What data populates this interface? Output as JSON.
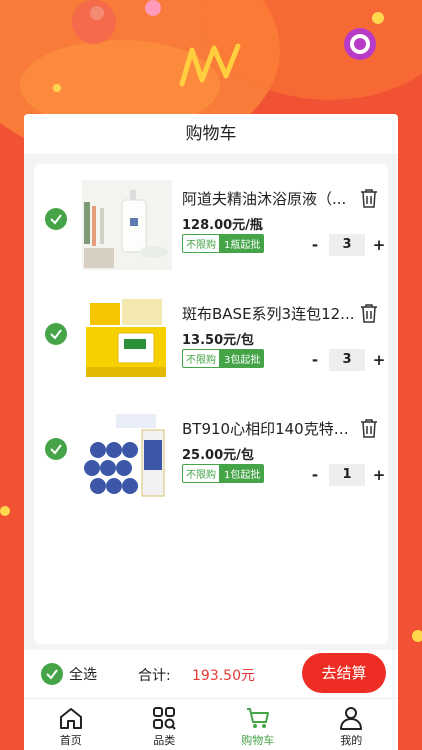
{
  "header": {
    "title": "购物车"
  },
  "items": [
    {
      "name": "阿道夫精油沐浴原液（...",
      "price": "128.00元/瓶",
      "tag_policy": "不限购",
      "tag_min": "1瓶起批",
      "qty": "3",
      "thumb": "bottle-image"
    },
    {
      "name": "斑布BASE系列3连包12...",
      "price": "13.50元/包",
      "tag_policy": "不限购",
      "tag_min": "3包起批",
      "qty": "3",
      "thumb": "tissue-box-image"
    },
    {
      "name": "BT910心相印140克特柔...",
      "price": "25.00元/包",
      "tag_policy": "不限购",
      "tag_min": "1包起批",
      "qty": "1",
      "thumb": "toilet-roll-image"
    }
  ],
  "footer": {
    "select_all": "全选",
    "total_label": "合计:",
    "total_value": "193.50元",
    "checkout": "去结算"
  },
  "tabs": [
    {
      "label": "首页",
      "icon": "home-icon"
    },
    {
      "label": "品类",
      "icon": "category-icon"
    },
    {
      "label": "购物车",
      "icon": "cart-icon"
    },
    {
      "label": "我的",
      "icon": "user-icon"
    }
  ],
  "colors": {
    "background": "#f15233",
    "accent": "#44a447",
    "checkout": "#ee2e24",
    "price": "#e53935"
  }
}
